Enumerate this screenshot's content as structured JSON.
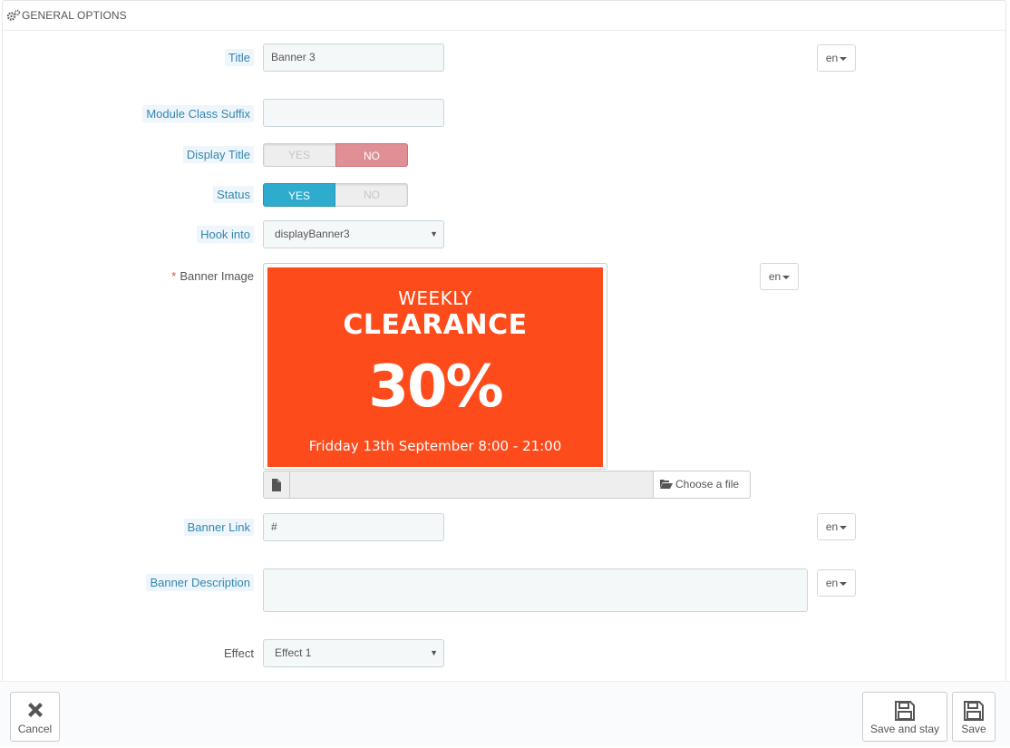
{
  "panel": {
    "heading": "GENERAL OPTIONS"
  },
  "lang": "en",
  "form": {
    "title": {
      "label": "Title",
      "value": "Banner 3"
    },
    "module_class_suffix": {
      "label": "Module Class Suffix",
      "value": ""
    },
    "display_title": {
      "label": "Display Title",
      "yes": "YES",
      "no": "NO",
      "selected": "NO"
    },
    "status": {
      "label": "Status",
      "yes": "YES",
      "no": "NO",
      "selected": "YES"
    },
    "hook_into": {
      "label": "Hook into",
      "value": "displayBanner3"
    },
    "banner_image": {
      "label": "Banner Image",
      "required_mark": "*",
      "preview": {
        "line1": "WEEKLY",
        "line2": "CLEARANCE",
        "line3": "30%",
        "line4": "Friddау 13th September 8:00 - 21:00",
        "bg_color": "#fd4b1c"
      },
      "choose_label": "Choose a file"
    },
    "banner_link": {
      "label": "Banner Link",
      "value": "#"
    },
    "banner_description": {
      "label": "Banner Description",
      "value": ""
    },
    "effect": {
      "label": "Effect",
      "value": "Effect 1"
    }
  },
  "footer": {
    "cancel": "Cancel",
    "save_and_stay": "Save and stay",
    "save": "Save"
  },
  "colors": {
    "switch_yes": "#2eacce",
    "switch_no": "#e08f95",
    "label_hint_bg": "#eef6fb",
    "label_hint_text": "#3586ae"
  }
}
